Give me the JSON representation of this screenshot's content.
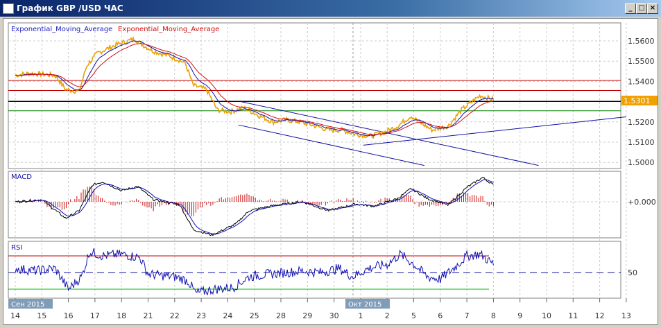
{
  "window": {
    "title": "График GBP /USD  ЧАС",
    "buttons": [
      "_",
      "□",
      "×"
    ]
  },
  "chart_data": [
    {
      "type": "line",
      "title": "GBP/USD price",
      "legend": [
        "Exponential_Moving_Average",
        "Exponential_Moving_Average"
      ],
      "legend_colors": [
        "#2020c0",
        "#d01010"
      ],
      "yticks": [
        "1.5600",
        "1.5500",
        "1.5400",
        "1.5200",
        "1.5100",
        "1.5000"
      ],
      "ylim": [
        1.4985,
        1.5655
      ],
      "current_price": "1.5301",
      "hlines": [
        {
          "value": 1.5405,
          "color": "#c00000"
        },
        {
          "value": 1.5355,
          "color": "#c00000"
        },
        {
          "value": 1.5301,
          "color": "#000000"
        },
        {
          "value": 1.5255,
          "color": "#008000"
        }
      ],
      "trendlines": [
        {
          "from": [
            8.4,
            1.5185
          ],
          "to": [
            15.4,
            1.4985
          ],
          "color": "#1010a0"
        },
        {
          "from": [
            8.5,
            1.53
          ],
          "to": [
            19.7,
            1.4985
          ],
          "color": "#1010a0"
        },
        {
          "from": [
            13.1,
            1.5085
          ],
          "to": [
            23,
            1.5225
          ],
          "color": "#1010a0"
        }
      ],
      "price": [
        [
          0,
          1.543
        ],
        [
          0.5,
          1.544
        ],
        [
          1.5,
          1.543
        ],
        [
          1.9,
          1.536
        ],
        [
          2.4,
          1.535
        ],
        [
          2.7,
          1.548
        ],
        [
          3.1,
          1.554
        ],
        [
          3.6,
          1.557
        ],
        [
          4,
          1.559
        ],
        [
          4.5,
          1.561
        ],
        [
          4.8,
          1.558
        ],
        [
          5.2,
          1.555
        ],
        [
          5.7,
          1.553
        ],
        [
          6.1,
          1.551
        ],
        [
          6.4,
          1.549
        ],
        [
          6.7,
          1.538
        ],
        [
          7.2,
          1.536
        ],
        [
          7.6,
          1.526
        ],
        [
          8.1,
          1.525
        ],
        [
          8.6,
          1.527
        ],
        [
          9.2,
          1.523
        ],
        [
          9.7,
          1.52
        ],
        [
          10.2,
          1.521
        ],
        [
          10.7,
          1.52
        ],
        [
          11.3,
          1.518
        ],
        [
          11.8,
          1.516
        ],
        [
          12.3,
          1.516
        ],
        [
          12.8,
          1.514
        ],
        [
          13.4,
          1.513
        ],
        [
          13.9,
          1.515
        ],
        [
          14.4,
          1.518
        ],
        [
          14.9,
          1.523
        ],
        [
          15.2,
          1.52
        ],
        [
          15.7,
          1.516
        ],
        [
          16.3,
          1.518
        ],
        [
          16.8,
          1.526
        ],
        [
          17.1,
          1.529
        ],
        [
          17.5,
          1.533
        ],
        [
          18,
          1.531
        ]
      ]
    },
    {
      "type": "line",
      "title": "MACD",
      "yticks": [
        "+0.000"
      ],
      "ylim": [
        -0.003,
        0.003
      ],
      "macd": [
        [
          0,
          0
        ],
        [
          1,
          0.0002
        ],
        [
          1.9,
          -0.0015
        ],
        [
          2.4,
          -0.0008
        ],
        [
          2.9,
          0.0015
        ],
        [
          3.3,
          0.0018
        ],
        [
          4,
          0.001
        ],
        [
          4.6,
          0.0014
        ],
        [
          5.2,
          0.0002
        ],
        [
          6.2,
          -0.0003
        ],
        [
          6.7,
          -0.0025
        ],
        [
          7.4,
          -0.003
        ],
        [
          8.3,
          -0.002
        ],
        [
          8.8,
          -0.0008
        ],
        [
          9.8,
          -0.0003
        ],
        [
          10.8,
          0
        ],
        [
          11.8,
          -0.0008
        ],
        [
          12.8,
          -0.0002
        ],
        [
          13.5,
          -0.0004
        ],
        [
          14.4,
          0.0003
        ],
        [
          14.9,
          0.0012
        ],
        [
          15.5,
          0.0003
        ],
        [
          16.3,
          -0.0003
        ],
        [
          17,
          0.0013
        ],
        [
          17.6,
          0.0022
        ],
        [
          18,
          0.0015
        ]
      ]
    },
    {
      "type": "line",
      "title": "RSI",
      "yticks": [
        "50"
      ],
      "ylim": [
        20,
        85
      ],
      "levels": [
        30,
        70
      ],
      "rsi": [
        [
          0,
          55
        ],
        [
          0.8,
          52
        ],
        [
          1.5,
          55
        ],
        [
          2,
          30
        ],
        [
          2.5,
          45
        ],
        [
          2.8,
          75
        ],
        [
          3.3,
          70
        ],
        [
          4,
          72
        ],
        [
          4.7,
          68
        ],
        [
          5,
          48
        ],
        [
          6,
          45
        ],
        [
          6.5,
          40
        ],
        [
          6.8,
          25
        ],
        [
          7.5,
          30
        ],
        [
          8.2,
          32
        ],
        [
          8.8,
          45
        ],
        [
          9.5,
          48
        ],
        [
          10.2,
          50
        ],
        [
          10.8,
          52
        ],
        [
          11.5,
          50
        ],
        [
          12.2,
          55
        ],
        [
          12.7,
          45
        ],
        [
          13.3,
          55
        ],
        [
          14,
          60
        ],
        [
          14.5,
          72
        ],
        [
          15,
          60
        ],
        [
          15.5,
          45
        ],
        [
          16,
          42
        ],
        [
          16.5,
          55
        ],
        [
          17,
          70
        ],
        [
          17.5,
          72
        ],
        [
          18,
          60
        ]
      ]
    }
  ],
  "xaxis": {
    "month_labels": [
      "Сен 2015",
      "Окт 2015"
    ],
    "days": [
      "14",
      "15",
      "16",
      "17",
      "18",
      "21",
      "22",
      "23",
      "24",
      "25",
      "28",
      "29",
      "30",
      "1",
      "2",
      "5",
      "6",
      "7",
      "8",
      "9",
      "10",
      "11",
      "12",
      "13"
    ]
  }
}
